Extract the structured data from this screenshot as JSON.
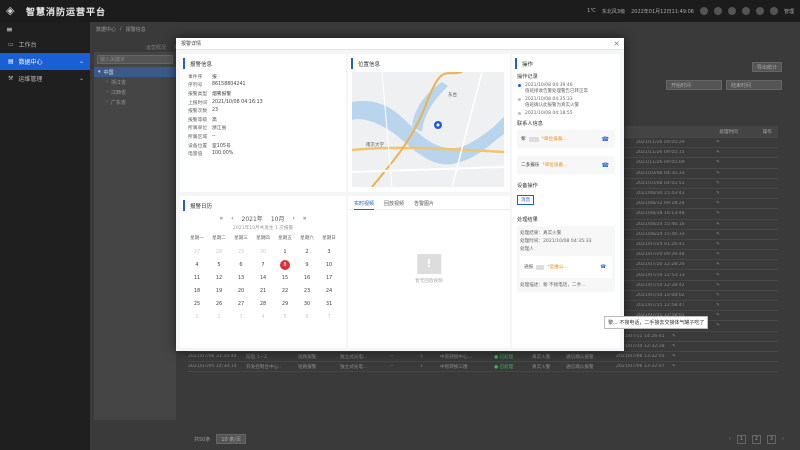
{
  "app": {
    "title": "智慧消防运营平台",
    "top_right": [
      "1℃",
      "东北风3级",
      "2022年01月12日11:49:06"
    ],
    "user": "管理"
  },
  "sidebar": {
    "items": [
      {
        "label": "工作台"
      },
      {
        "label": "数据中心",
        "active": true
      },
      {
        "label": "运维管理"
      }
    ]
  },
  "breadcrumb": [
    "数据中心",
    "/",
    "报警信息"
  ],
  "page_tabs": [
    "运营概况",
    "报警"
  ],
  "tree": {
    "placeholder": "输入关键字",
    "nodes": [
      {
        "label": "中国",
        "selected": true
      },
      {
        "label": "浙江省"
      },
      {
        "label": "江西省"
      },
      {
        "label": "广东省"
      }
    ]
  },
  "right_buttons": {
    "export": "导出统计",
    "start_time": "开始时间",
    "end_time": "结束时间"
  },
  "grid": {
    "headers": [
      "",
      "",
      "",
      "",
      "",
      "",
      "",
      "处理描述",
      "处理时间",
      "操作"
    ],
    "rows": [
      [
        "",
        "",
        "",
        "",
        "",
        "",
        "",
        "误报",
        "2021/11/26 09:05:29"
      ],
      [
        "",
        "",
        "",
        "",
        "",
        "",
        "",
        "误报",
        "2021/11/26 09:05:15"
      ],
      [
        "",
        "",
        "",
        "",
        "",
        "",
        "",
        "",
        "2021/11/26 09:05:09"
      ],
      [
        "",
        "",
        "",
        "",
        "",
        "",
        "",
        "不确电话",
        "2021/10/08 04:35:33"
      ],
      [
        "",
        "",
        "",
        "",
        "",
        "",
        "",
        "听气泵漏入..",
        "2021/10/08 04:02:51"
      ],
      [
        "",
        "",
        "",
        "",
        "",
        "",
        "",
        "已处理",
        "2021/08/30 15:43:43"
      ],
      [
        "",
        "",
        "",
        "",
        "",
        "",
        "",
        "位置需要更新",
        "2021/08/12 09:18:24"
      ],
      [
        "",
        "",
        "",
        "",
        "",
        "",
        "",
        "通信确认报警",
        "2021/08/28 16:13:48"
      ],
      [
        "",
        "",
        "",
        "",
        "",
        "",
        "",
        "通信确认报警",
        "2021/08/24 15:46:16"
      ],
      [
        "",
        "",
        "",
        "",
        "",
        "",
        "",
        "通信确认报警",
        "2021/08/24 15:46:33"
      ],
      [
        "",
        "",
        "",
        "",
        "",
        "",
        "",
        "通信确认报警",
        "2021/07/24 01:26:41"
      ],
      [
        "",
        "",
        "",
        "",
        "",
        "",
        "",
        "通信确认报警",
        "2021/07/20 09:26:48"
      ],
      [
        "",
        "",
        "",
        "",
        "",
        "",
        "",
        "通信确认报警",
        "2021/07/20 12:28:26"
      ],
      [
        "",
        "",
        "",
        "",
        "",
        "",
        "",
        "通信确认报警",
        "2021/07/19 12:53:13"
      ],
      [
        "",
        "",
        "",
        "",
        "",
        "",
        "",
        "通信确认报警",
        "2021/07/10 12:28:42"
      ],
      [
        "",
        "",
        "",
        "",
        "",
        "",
        "",
        "通信确认报警",
        "2021/07/10 10:08:02"
      ],
      [
        "",
        "",
        "",
        "",
        "",
        "",
        "",
        "通信确认报警",
        "2021/07/15 12:58:47"
      ],
      [
        "",
        "",
        "",
        "",
        "",
        "",
        "",
        "",
        "2021/07/15 12:58:01"
      ],
      [
        "",
        "",
        "",
        "",
        "",
        "",
        "",
        "",
        "2021/07/09 12:14:43"
      ],
      [
        "2021/07/11 15:34:42",
        "表树区",
        "短路报警",
        "独立式光电...",
        "--",
        "1",
        "中管转换器件",
        "● 已处理",
        "真实火警",
        "通信确认报警",
        "2021/07/11 14:26:41"
      ],
      [
        "2021/07/10 12:31:54",
        "开发出控制台...",
        "短路报警",
        "独立式光电...",
        "--",
        "1",
        "中管转换器件",
        "● 已处理",
        "真实火警",
        "通信确认报警",
        "2021/07/10 12:32:28"
      ],
      [
        "2021/07/06 31:35:44",
        "前后 1—2",
        "短路报警",
        "独立式光电...",
        "--",
        "1",
        "中管转换中心...",
        "● 已处理",
        "真实火警",
        "通信确认报警",
        "2021/07/06 13:32:05"
      ],
      [
        "2021/07/05 14:34:14",
        "开发控制台中心..",
        "短路报警",
        "独立式光电...",
        "--",
        "1",
        "中管转换三楼",
        "● 已处理",
        "真实火警",
        "通信确认报警",
        "2021/07/06 13:32:07"
      ]
    ]
  },
  "pager": {
    "total_label": "共50条",
    "page_size": "10 条/页",
    "pages": [
      "1",
      "2",
      "3"
    ]
  },
  "modal": {
    "title": "报警详情",
    "close": "×",
    "alarm_info": {
      "title": "报警信息",
      "fields": [
        {
          "k": "事件序",
          "v": "报"
        },
        {
          "k": "序列号",
          "v": "86158804241"
        },
        {
          "k": "报警类型",
          "v": "烟雾报警"
        },
        {
          "k": "上报时间",
          "v": "2021/10/08 04:16:13"
        },
        {
          "k": "报警次数",
          "v": "23"
        },
        {
          "k": "报警等级",
          "v": "高"
        },
        {
          "k": "所属单位",
          "v": "浙江省"
        },
        {
          "k": "所属区域",
          "v": "--"
        },
        {
          "k": "设备位置",
          "v": "室105号"
        },
        {
          "k": "电量值",
          "v": "100.00%"
        }
      ]
    },
    "location": {
      "title": "位置信息",
      "labels": [
        "南京大学",
        "东台"
      ]
    },
    "calendar": {
      "title": "报警日历",
      "year": "2021年",
      "month": "10月",
      "subtitle": "2021年10月共发生 1 次报警",
      "weekdays": [
        "星期一",
        "星期二",
        "星期三",
        "星期四",
        "星期五",
        "星期六",
        "星期日"
      ],
      "days": [
        "27",
        "28",
        "29",
        "30",
        "1",
        "2",
        "3",
        "4",
        "5",
        "6",
        "7",
        "8",
        "9",
        "10",
        "11",
        "12",
        "13",
        "14",
        "15",
        "16",
        "17",
        "18",
        "19",
        "20",
        "21",
        "22",
        "23",
        "24",
        "25",
        "26",
        "27",
        "28",
        "29",
        "30",
        "31",
        "1",
        "2",
        "3",
        "4",
        "5",
        "6",
        "7"
      ],
      "today": "8"
    },
    "media": {
      "tabs": [
        "实时视频",
        "回放视频",
        "告警图片"
      ],
      "empty": "暂无回放视频"
    },
    "ops": {
      "title": "操作",
      "log_title": "操作记录",
      "log": [
        {
          "time": "2021/10/08 04:39:46",
          "text": "值班接收告警处理警告已转正常"
        },
        {
          "time": "2021/10/08 04:35:33",
          "text": "值班确认此报警为真实火警"
        },
        {
          "time": "2021/10/08 04:18:55",
          "text": ""
        }
      ],
      "contact_title": "联系人信息",
      "contacts": [
        {
          "name": "黎",
          "tag": "*单位设备...",
          "phone": "☎"
        },
        {
          "name": "二多报乐",
          "tag": "*单位设备...",
          "phone": "☎"
        }
      ],
      "device_title": "设备操作",
      "device_btn": "消音",
      "result_title": "处理结果",
      "result": {
        "r1": "处理结果：真实火警",
        "r2": "处理时间：2021/10/08 04:35:33",
        "r3": "处理人",
        "card_name": "通报",
        "card_tag": "*运维公...",
        "desc": "处理描述：黎     不接电话，二手..."
      }
    },
    "tooltip": "黎... 不接电话，二手接去交接体气罐子吃了"
  }
}
